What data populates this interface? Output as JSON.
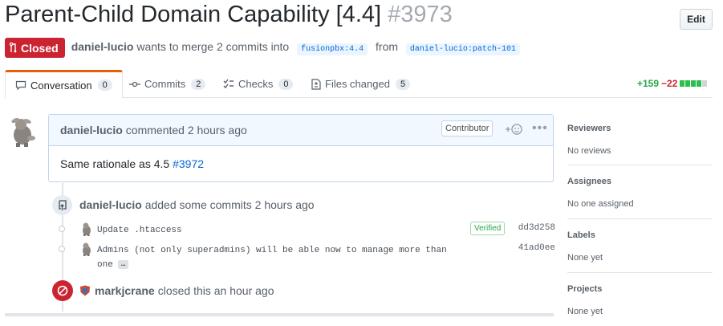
{
  "header": {
    "title": "Parent-Child Domain Capability [4.4]",
    "number": "#3973",
    "edit_label": "Edit"
  },
  "meta": {
    "state": "Closed",
    "author": "daniel-lucio",
    "wants_to_merge": "wants to merge 2 commits into",
    "base_branch": "fusionpbx:4.4",
    "from_word": "from",
    "head_branch": "daniel-lucio:patch-101"
  },
  "tabs": [
    {
      "label": "Conversation",
      "count": "0",
      "icon": "comment-icon"
    },
    {
      "label": "Commits",
      "count": "2",
      "icon": "commit-icon"
    },
    {
      "label": "Checks",
      "count": "0",
      "icon": "checklist-icon"
    },
    {
      "label": "Files changed",
      "count": "5",
      "icon": "file-diff-icon"
    }
  ],
  "diffstat": {
    "additions": "+159",
    "deletions": "−22",
    "colors": {
      "add": "#2cbe4e",
      "neutral": "#d1d5da"
    }
  },
  "comment": {
    "author": "daniel-lucio",
    "action": "commented",
    "time": "2 hours ago",
    "role_badge": "Contributor",
    "body_text": "Same rationale as 4.5",
    "body_link": "#3972"
  },
  "commits_event": {
    "author": "daniel-lucio",
    "text": "added some commits",
    "time": "2 hours ago",
    "commits": [
      {
        "message": "Update .htaccess",
        "verified": "Verified",
        "sha": "dd3d258"
      },
      {
        "message": "Admins (not only superadmins) will be able now to manage more than",
        "message_cont": "one",
        "sha": "41ad0ee",
        "more": "…"
      }
    ]
  },
  "close_event": {
    "author": "markjcrane",
    "text": "closed this",
    "time": "an hour ago"
  },
  "sidebar": {
    "sections": [
      {
        "heading": "Reviewers",
        "value": "No reviews"
      },
      {
        "heading": "Assignees",
        "value": "No one assigned"
      },
      {
        "heading": "Labels",
        "value": "None yet"
      },
      {
        "heading": "Projects",
        "value": "None yet"
      }
    ]
  },
  "colors": {
    "closed_red": "#cb2431",
    "link_blue": "#0366d6",
    "tab_accent": "#e36209"
  }
}
